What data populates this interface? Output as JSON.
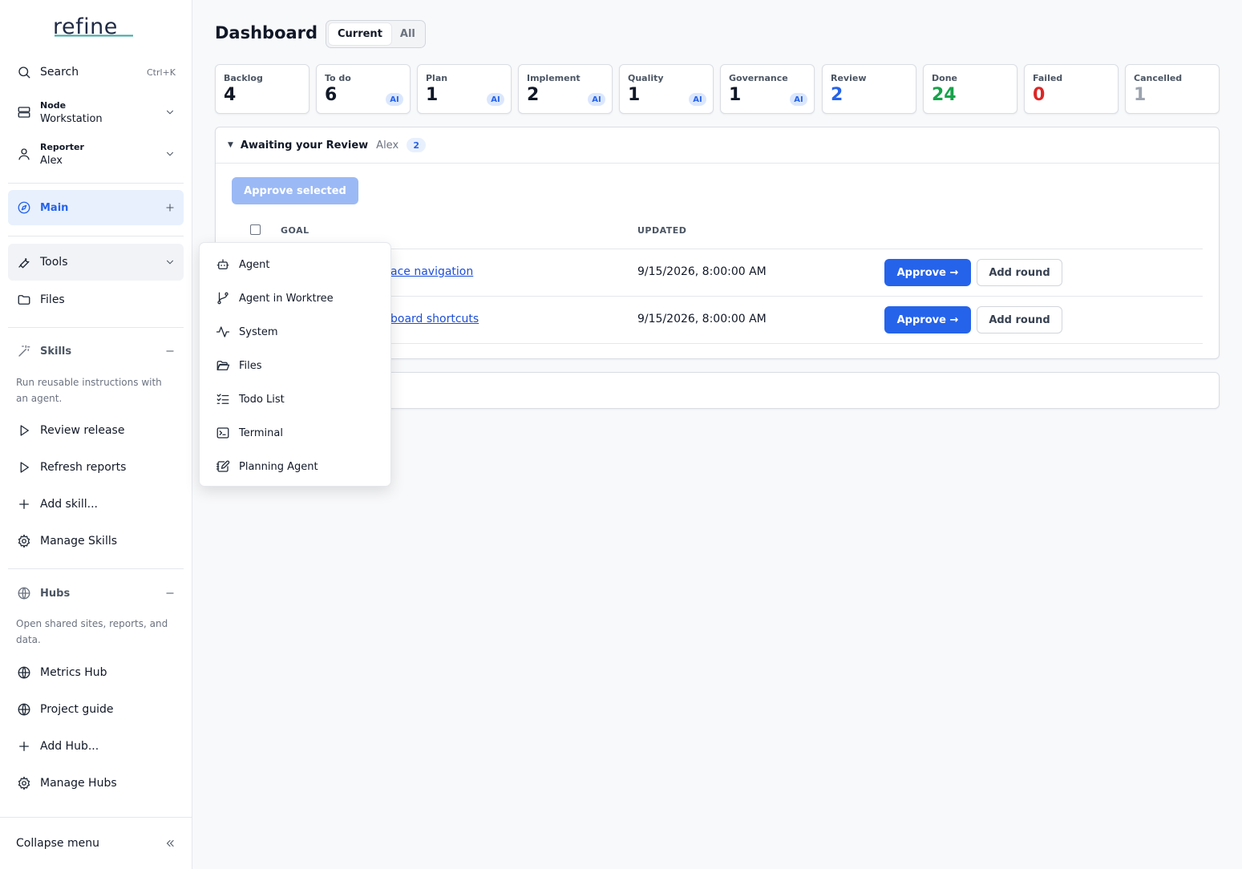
{
  "app": {
    "logo": "refine"
  },
  "sidebar": {
    "search": {
      "label": "Search",
      "shortcut": "Ctrl+K"
    },
    "node": {
      "label": "Node",
      "value": "Workstation"
    },
    "reporter": {
      "label": "Reporter",
      "value": "Alex"
    },
    "main": {
      "label": "Main"
    },
    "tools": {
      "label": "Tools"
    },
    "files": {
      "label": "Files"
    },
    "skills": {
      "title": "Skills",
      "description": "Run reusable instructions with an agent.",
      "items": [
        "Review release",
        "Refresh reports",
        "Add skill...",
        "Manage Skills"
      ]
    },
    "hubs": {
      "title": "Hubs",
      "description": "Open shared sites, reports, and data.",
      "items": [
        "Metrics Hub",
        "Project guide",
        "Add Hub...",
        "Manage Hubs"
      ]
    },
    "collapse": {
      "label": "Collapse menu"
    }
  },
  "header": {
    "title": "Dashboard",
    "toggle": [
      "Current",
      "All"
    ]
  },
  "stats": [
    {
      "label": "Backlog",
      "value": "4",
      "color": "#111827",
      "ai": ""
    },
    {
      "label": "To do",
      "value": "6",
      "color": "#111827",
      "ai": "AI"
    },
    {
      "label": "Plan",
      "value": "1",
      "color": "#111827",
      "ai": "AI"
    },
    {
      "label": "Implement",
      "value": "2",
      "color": "#111827",
      "ai": "AI"
    },
    {
      "label": "Quality",
      "value": "1",
      "color": "#111827",
      "ai": "AI"
    },
    {
      "label": "Governance",
      "value": "1",
      "color": "#111827",
      "ai": "AI"
    },
    {
      "label": "Review",
      "value": "2",
      "color": "#2563eb",
      "ai": ""
    },
    {
      "label": "Done",
      "value": "24",
      "color": "#16a34a",
      "ai": ""
    },
    {
      "label": "Failed",
      "value": "0",
      "color": "#dc2626",
      "ai": ""
    },
    {
      "label": "Cancelled",
      "value": "1",
      "color": "#9ca3af",
      "ai": ""
    }
  ],
  "review": {
    "title": "Awaiting your Review",
    "who": "Alex",
    "count": "2",
    "approve_selected": "Approve selected",
    "columns": {
      "goal": "GOAL",
      "updated": "UPDATED"
    },
    "rows": [
      {
        "goal": "ace navigation",
        "updated": "9/15/2026, 8:00:00 AM",
        "approve": "Approve →",
        "add_round": "Add round"
      },
      {
        "goal": "board shortcuts",
        "updated": "9/15/2026, 8:00:00 AM",
        "approve": "Approve →",
        "add_round": "Add round"
      }
    ]
  },
  "tools_menu": {
    "items": [
      "Agent",
      "Agent in Worktree",
      "System",
      "Files",
      "Todo List",
      "Terminal",
      "Planning Agent"
    ]
  }
}
